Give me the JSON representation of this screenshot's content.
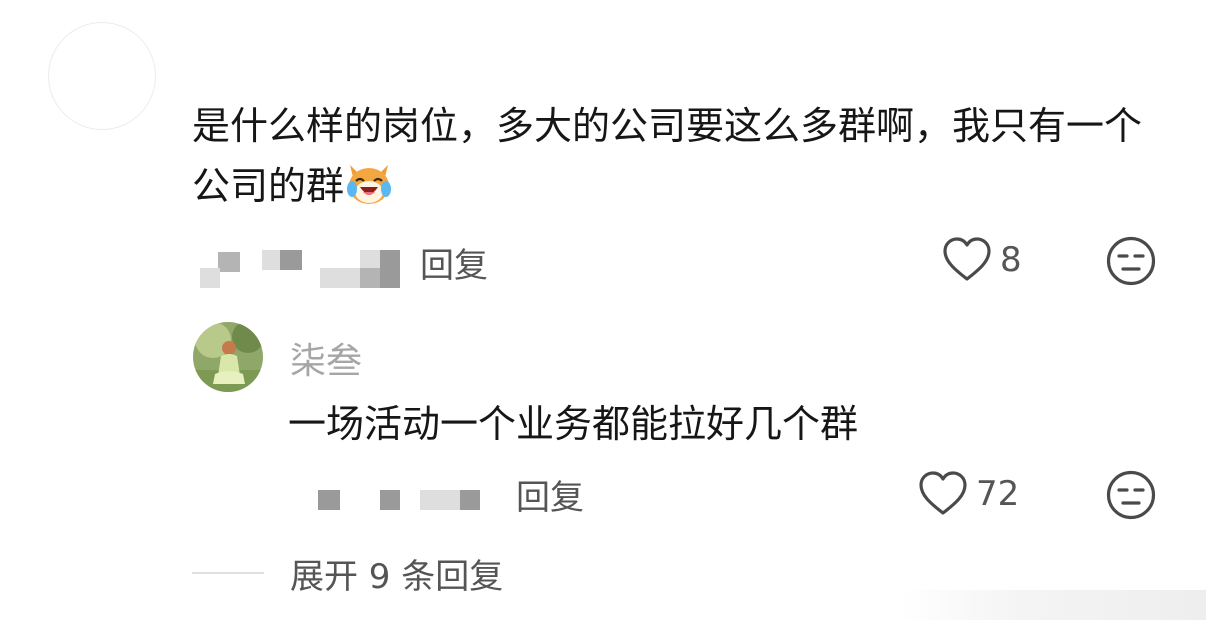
{
  "comment": {
    "text": "是什么样的岗位，多大的公司要这么多群啊，我只有一个公司的群",
    "emoji_icon": "crying-laughing-cat-icon",
    "reply_label": "回复",
    "like_count": "8"
  },
  "reply": {
    "username": "柒叁",
    "text": "一场活动一个业务都能拉好几个群",
    "reply_label": "回复",
    "like_count": "72"
  },
  "expand": {
    "label": "展开 9 条回复"
  },
  "colors": {
    "text_primary": "#161616",
    "text_secondary": "#555555",
    "username": "#a6a6a6",
    "icon_stroke": "#4a4a4a"
  }
}
